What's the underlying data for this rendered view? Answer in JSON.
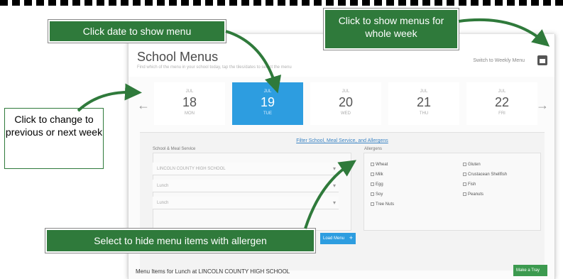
{
  "app": {
    "title": "School Menus",
    "subtitle": "Find which of the menu in your school today, tap the tiles/dates to select the menu",
    "switch_label": "Switch to Weekly Menu"
  },
  "dates": [
    {
      "mon": "JUL",
      "num": "18",
      "dow": "MON",
      "selected": false
    },
    {
      "mon": "JUL",
      "num": "19",
      "dow": "TUE",
      "selected": true
    },
    {
      "mon": "JUL",
      "num": "20",
      "dow": "WED",
      "selected": false
    },
    {
      "mon": "JUL",
      "num": "21",
      "dow": "THU",
      "selected": false
    },
    {
      "mon": "JUL",
      "num": "22",
      "dow": "FRI",
      "selected": false
    }
  ],
  "filters": {
    "link": "Filter School, Meal Service, and Allergens",
    "school_label": "School & Meal Service",
    "selects": [
      "LINCOLN COUNTY HIGH SCHOOL",
      "Lunch",
      "Lunch"
    ],
    "allergen_label": "Allergens",
    "allergens": [
      "Wheat",
      "Milk",
      "Egg",
      "Soy",
      "Tree Nuts",
      "Gluten",
      "Crustacean Shellfish",
      "Fish",
      "Peanuts"
    ]
  },
  "buttons": {
    "load": "Load Menu",
    "tray": "Make a Tray"
  },
  "menu_title": "Menu Items for Lunch at LINCOLN COUNTY HIGH SCHOOL",
  "callouts": {
    "date": "Click date to show menu",
    "week": "Click to show menus for whole week",
    "prevnext": "Click to change to previous or next week",
    "allergen": "Select to hide menu items with allergen"
  },
  "colors": {
    "accent": "#2d9de0",
    "callout": "#2f7a3b",
    "tray": "#3c9a4f"
  }
}
